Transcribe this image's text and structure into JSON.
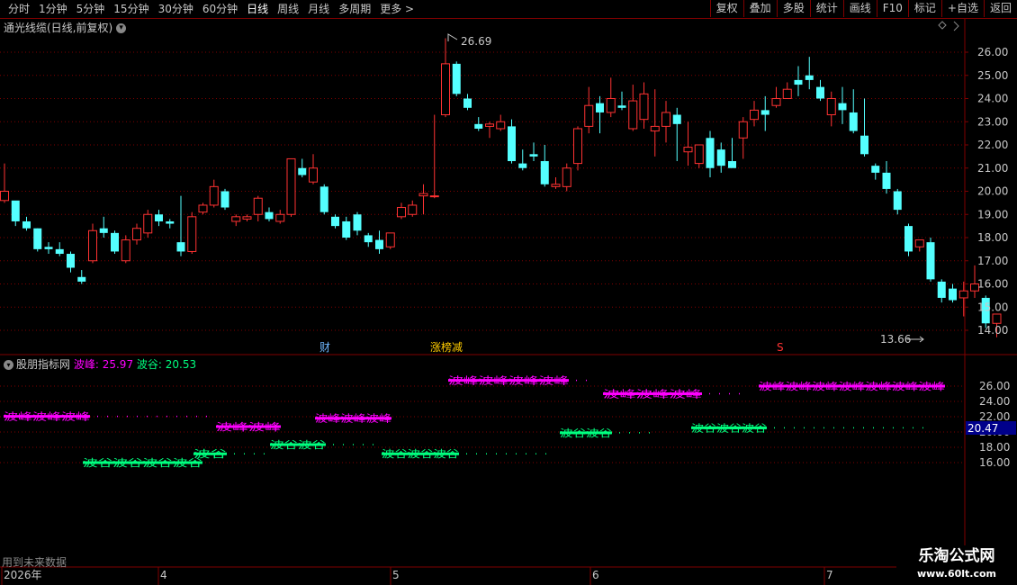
{
  "toolbar": {
    "periods": [
      "分时",
      "1分钟",
      "5分钟",
      "15分钟",
      "30分钟",
      "60分钟",
      "日线",
      "周线",
      "月线",
      "多周期",
      "更多 >"
    ],
    "active_period": "日线",
    "right_buttons": [
      "复权",
      "叠加",
      "多股",
      "统计",
      "画线",
      "F10",
      "标记",
      "+自选",
      "返回"
    ]
  },
  "main_chart": {
    "title": "通光线缆(日线,前复权)",
    "high_label": "26.69",
    "low_label": "13.66",
    "price_ticks": [
      "26.00",
      "25.00",
      "24.00",
      "23.00",
      "22.00",
      "21.00",
      "20.00",
      "19.00",
      "18.00",
      "17.00",
      "16.00",
      "15.00",
      "14.00"
    ],
    "markers": [
      "财",
      "涨榜减",
      "S"
    ]
  },
  "indicator": {
    "name": "股朋指标网",
    "peak_label": "波峰:",
    "peak_value": "25.97",
    "trough_label": "波谷:",
    "trough_value": "20.53",
    "ticks": [
      "26.00",
      "24.00",
      "22.00",
      "20.00",
      "18.00",
      "16.00"
    ],
    "current_value": "20.47",
    "peak_text": "波峰",
    "trough_text": "波谷"
  },
  "footer": {
    "note": "用到未来数据",
    "date_labels": [
      "2026年",
      "4",
      "5",
      "6",
      "7"
    ]
  },
  "watermark": {
    "line1": "乐淘公式网",
    "line2": "www.60lt.com"
  },
  "colors": {
    "up": "#ff3232",
    "down": "#54ffff",
    "peak": "#ff00ff",
    "trough": "#00ff7f",
    "grid": "#800000"
  },
  "chart_data": {
    "type": "candlestick",
    "ylim": [
      13.5,
      26.8
    ],
    "candles": [
      [
        19.6,
        21.2,
        20.0,
        19.5
      ],
      [
        19.6,
        19.5,
        18.7,
        18.5
      ],
      [
        18.7,
        18.9,
        18.4,
        18.3
      ],
      [
        18.4,
        18.4,
        17.5,
        17.4
      ],
      [
        17.6,
        17.8,
        17.5,
        17.3
      ],
      [
        17.5,
        17.8,
        17.3,
        17.2
      ],
      [
        17.3,
        17.4,
        16.7,
        16.5
      ],
      [
        16.3,
        16.6,
        16.1,
        16.0
      ],
      [
        17.0,
        18.6,
        18.3,
        16.9
      ],
      [
        18.4,
        18.9,
        18.2,
        18.0
      ],
      [
        18.2,
        18.3,
        17.4,
        17.3
      ],
      [
        17.0,
        18.1,
        17.9,
        16.9
      ],
      [
        17.9,
        18.6,
        18.4,
        17.7
      ],
      [
        18.2,
        19.2,
        19.0,
        18.0
      ],
      [
        19.0,
        19.2,
        18.7,
        18.5
      ],
      [
        18.7,
        18.8,
        18.6,
        18.4
      ],
      [
        17.8,
        19.8,
        17.4,
        17.2
      ],
      [
        17.4,
        19.1,
        18.9,
        17.3
      ],
      [
        19.1,
        19.5,
        19.4,
        19.0
      ],
      [
        19.4,
        20.5,
        20.2,
        19.3
      ],
      [
        20.0,
        20.1,
        19.3,
        19.2
      ],
      [
        18.7,
        19.0,
        18.9,
        18.5
      ],
      [
        18.8,
        19.0,
        18.9,
        18.7
      ],
      [
        19.0,
        19.8,
        19.7,
        18.7
      ],
      [
        19.1,
        19.3,
        18.8,
        18.7
      ],
      [
        18.7,
        19.2,
        19.0,
        18.6
      ],
      [
        19.0,
        21.0,
        21.4,
        18.9
      ],
      [
        21.0,
        21.4,
        20.7,
        20.6
      ],
      [
        20.4,
        21.6,
        21.0,
        20.3
      ],
      [
        20.2,
        20.3,
        19.1,
        19.0
      ],
      [
        18.9,
        19.0,
        18.5,
        18.4
      ],
      [
        18.7,
        18.9,
        18.0,
        17.9
      ],
      [
        19.0,
        19.1,
        18.3,
        18.1
      ],
      [
        18.1,
        18.2,
        17.8,
        17.6
      ],
      [
        17.9,
        18.3,
        17.5,
        17.3
      ],
      [
        17.6,
        18.2,
        18.2,
        17.5
      ],
      [
        18.9,
        19.5,
        19.3,
        18.8
      ],
      [
        19.0,
        19.6,
        19.4,
        18.9
      ],
      [
        19.8,
        20.3,
        19.9,
        19.0
      ],
      [
        19.8,
        23.3,
        19.8,
        19.7
      ],
      [
        23.3,
        26.6,
        25.5,
        23.2
      ],
      [
        25.5,
        25.6,
        24.2,
        24.1
      ],
      [
        24.0,
        24.2,
        23.6,
        23.5
      ],
      [
        22.9,
        23.2,
        22.7,
        22.6
      ],
      [
        22.8,
        23.0,
        22.9,
        22.3
      ],
      [
        22.7,
        23.3,
        23.0,
        22.6
      ],
      [
        22.8,
        23.1,
        21.3,
        21.2
      ],
      [
        21.2,
        21.8,
        21.0,
        20.9
      ],
      [
        21.6,
        22.1,
        21.5,
        21.3
      ],
      [
        21.3,
        22.0,
        20.3,
        20.2
      ],
      [
        20.2,
        20.6,
        20.3,
        20.1
      ],
      [
        20.2,
        21.2,
        21.0,
        20.0
      ],
      [
        21.2,
        22.8,
        22.7,
        20.9
      ],
      [
        22.8,
        24.5,
        23.7,
        22.5
      ],
      [
        23.8,
        24.1,
        23.4,
        22.5
      ],
      [
        23.4,
        24.9,
        24.0,
        23.2
      ],
      [
        23.7,
        24.3,
        23.6,
        23.5
      ],
      [
        22.7,
        24.6,
        23.9,
        22.6
      ],
      [
        23.1,
        24.7,
        24.2,
        22.7
      ],
      [
        22.6,
        24.4,
        22.8,
        21.5
      ],
      [
        22.8,
        23.9,
        23.4,
        22.1
      ],
      [
        23.3,
        23.6,
        22.9,
        21.3
      ],
      [
        21.7,
        23.0,
        21.9,
        21.1
      ],
      [
        21.2,
        21.8,
        22.0,
        21.0
      ],
      [
        22.3,
        22.6,
        21.0,
        20.6
      ],
      [
        21.8,
        22.1,
        21.1,
        20.8
      ],
      [
        21.3,
        22.3,
        21.0,
        21.1
      ],
      [
        22.3,
        23.2,
        23.0,
        21.4
      ],
      [
        23.1,
        23.9,
        23.5,
        22.8
      ],
      [
        23.5,
        24.1,
        23.3,
        22.6
      ],
      [
        23.7,
        24.5,
        24.0,
        23.6
      ],
      [
        24.0,
        24.7,
        24.4,
        24.0
      ],
      [
        24.8,
        25.4,
        24.6,
        24.1
      ],
      [
        25.0,
        25.8,
        24.8,
        24.4
      ],
      [
        24.5,
        24.8,
        24.0,
        23.9
      ],
      [
        23.3,
        24.3,
        24.0,
        22.8
      ],
      [
        23.8,
        24.5,
        23.5,
        22.9
      ],
      [
        23.4,
        24.4,
        22.6,
        22.5
      ],
      [
        22.4,
        24.0,
        21.6,
        21.5
      ],
      [
        21.1,
        21.2,
        20.8,
        20.5
      ],
      [
        20.8,
        21.3,
        20.1,
        19.9
      ],
      [
        20.0,
        20.1,
        19.2,
        19.0
      ],
      [
        18.5,
        18.6,
        17.4,
        17.2
      ],
      [
        17.6,
        17.9,
        17.9,
        17.4
      ],
      [
        17.8,
        18.0,
        16.2,
        16.1
      ],
      [
        16.1,
        16.2,
        15.4,
        15.2
      ],
      [
        15.8,
        16.0,
        15.3,
        15.2
      ],
      [
        15.4,
        16.1,
        15.7,
        14.6
      ],
      [
        15.7,
        16.8,
        16.0,
        15.4
      ],
      [
        15.4,
        15.5,
        14.3,
        14.1
      ],
      [
        14.3,
        14.7,
        14.7,
        13.7
      ]
    ]
  }
}
